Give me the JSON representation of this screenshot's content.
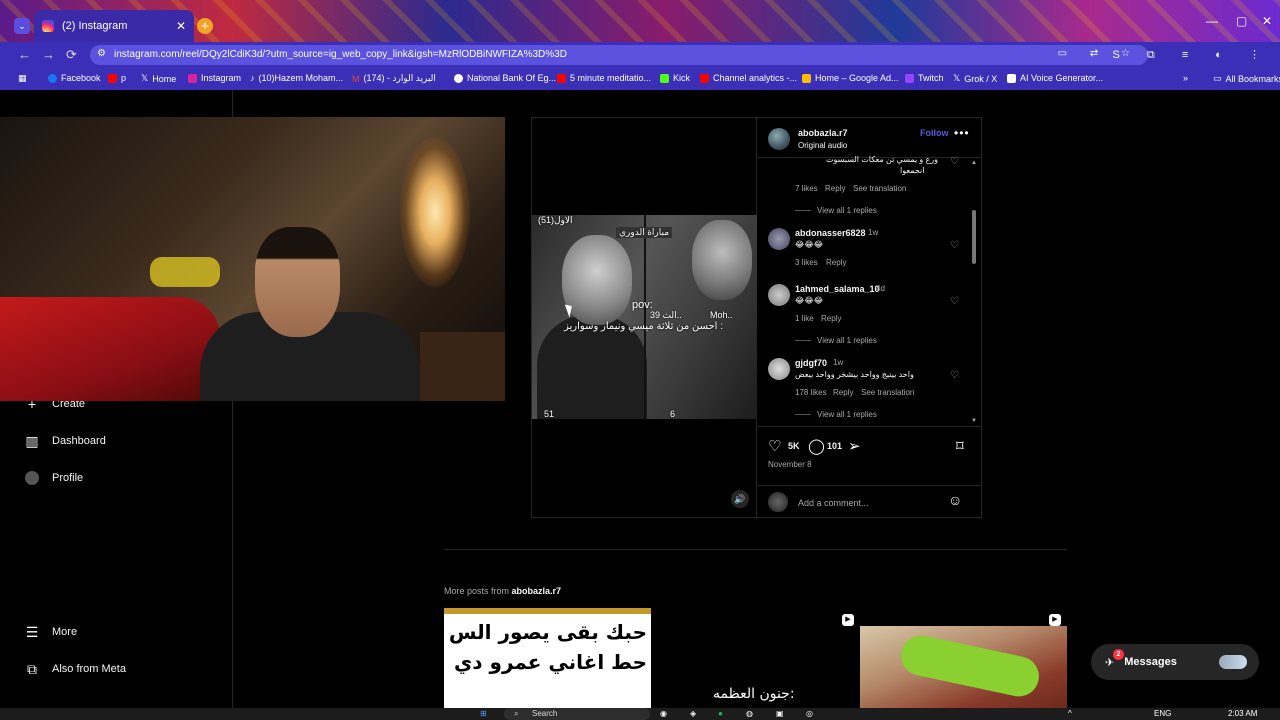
{
  "browser": {
    "tab_title": "(2) Instagram",
    "new_tab": "+",
    "url": "instagram.com/reel/DQy2lCdiK3d/?utm_source=ig_web_copy_link&igsh=MzRlODBiNWFIZA%3D%3D",
    "bookmarks": [
      {
        "label": "Facebook",
        "color": "#1877f2"
      },
      {
        "label": "p",
        "color": "#ff0000"
      },
      {
        "label": "Home",
        "color": "#000000"
      },
      {
        "label": "Instagram",
        "color": "#d6249f"
      },
      {
        "label": "(10)Hazem Moham...",
        "color": "#000000"
      },
      {
        "label": "(174) - البريد الوارد",
        "color": "#ea4335"
      },
      {
        "label": "National Bank Of Eg...",
        "color": "#0b6e4f"
      },
      {
        "label": "5 minute meditatio...",
        "color": "#ff0000"
      },
      {
        "label": "Kick",
        "color": "#53fc18"
      },
      {
        "label": "Channel analytics -...",
        "color": "#ff0000"
      },
      {
        "label": "Home – Google Ad...",
        "color": "#fbbc04"
      },
      {
        "label": "Twitch",
        "color": "#9146ff"
      },
      {
        "label": "Grok / X",
        "color": "#000000"
      },
      {
        "label": "AI Voice Generator...",
        "color": "#ffffff"
      }
    ],
    "all_bookmarks": "All Bookmarks"
  },
  "sidebar": {
    "create": "Create",
    "dashboard": "Dashboard",
    "profile": "Profile",
    "more": "More",
    "also_from_meta": "Also from Meta"
  },
  "video": {
    "overlay_top_left": "(51)الاول",
    "overlay_badge": "مباراة الدوري",
    "pov": "pov:",
    "caption": "احسن من ثلاثة ميسي ونيمار وسواريز :",
    "counter": "39 الث..",
    "name_tag": "Moh..",
    "bottom_left": "51",
    "bottom_right": "6"
  },
  "post": {
    "username": "abobazla.r7",
    "audio": "Original audio",
    "follow": "Follow",
    "comments": [
      {
        "user": "",
        "text": "انجمعوا",
        "text2": "ورع و يمسي تن معكات السبسوت",
        "likes": "7 likes",
        "reply": "Reply",
        "translate": "See translation",
        "replies": "View all 1 replies"
      },
      {
        "user": "abdonasser6828",
        "time": "1w",
        "text": "😂😂😂",
        "likes": "3 likes",
        "reply": "Reply"
      },
      {
        "user": "1ahmed_salama_10",
        "time": "4d",
        "text": "😂😂😂",
        "likes": "1 like",
        "reply": "Reply",
        "replies": "View all 1 replies"
      },
      {
        "user": "gjdgf70",
        "time": "1w",
        "text": "واحد بينيج وواحد بيشخر وواحد بيعض",
        "likes": "178 likes",
        "reply": "Reply",
        "translate": "See translation",
        "replies": "View all 1 replies"
      }
    ],
    "likes_count": "5K",
    "comments_count": "101",
    "date": "November 8",
    "add_comment_placeholder": "Add a comment..."
  },
  "more_posts": {
    "prefix": "More posts from",
    "user": "abobazla.r7",
    "thumb1_line1": "حبك بقى يصور الس",
    "thumb1_line2": "حط اغاني عمرو دي",
    "thumb2_text": "جنون العظمه:"
  },
  "messages": {
    "label": "Messages",
    "badge": "2"
  },
  "taskbar": {
    "search": "Search",
    "lang": "ENG",
    "time": "2:03 AM"
  },
  "colors": {
    "accent": "#4f5bd5",
    "browser": "#3b2fb8",
    "bg": "#000000"
  }
}
